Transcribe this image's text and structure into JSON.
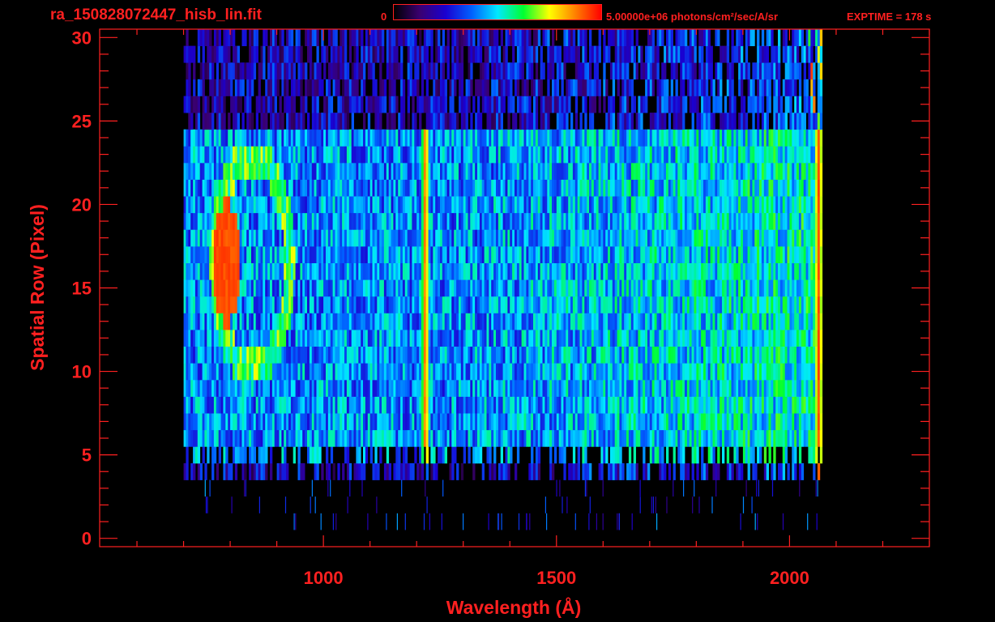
{
  "header": {
    "filename": "ra_150828072447_hisb_lin.fit",
    "colorbar_min_label": "0",
    "colorbar_max_label": "5.00000e+06 photons/cm²/sec/A/sr",
    "exptime_label": "EXPTIME = 178 s"
  },
  "colors": {
    "axis": "#ff2020",
    "background": "#000000",
    "colormap": [
      "#000000",
      "#3a0070",
      "#1a00d0",
      "#0060ff",
      "#00e8ff",
      "#00ff30",
      "#ffff00",
      "#ff8000",
      "#ff0000"
    ]
  },
  "chart_data": {
    "type": "heatmap",
    "title": "",
    "xlabel": "Wavelength (Å)",
    "ylabel": "Spatial Row (Pixel)",
    "xlim": [
      520,
      2300
    ],
    "ylim": [
      -0.5,
      30.5
    ],
    "xticks": [
      1000,
      1500,
      2000
    ],
    "xtick_labels": [
      "1000",
      "1500",
      "2000"
    ],
    "yticks": [
      0,
      5,
      10,
      15,
      20,
      25,
      30
    ],
    "ytick_labels": [
      "0",
      "5",
      "10",
      "15",
      "20",
      "25",
      "30"
    ],
    "x_minor_step": 100,
    "y_minor_step": 1,
    "colorbar_range": [
      0,
      5000000
    ],
    "colorbar_units": "photons/cm²/sec/A/sr",
    "data_extent": {
      "x": [
        700,
        2065
      ],
      "rows": [
        4,
        30
      ]
    },
    "features": [
      {
        "label": "",
        "wavelength": 1216,
        "rows": [
          5,
          24
        ],
        "level": 0.85
      },
      {
        "label": "",
        "wavelength": 1030,
        "rows": [
          5,
          23
        ],
        "level": 0.4
      },
      {
        "label": "",
        "wavelength": 1800,
        "rows": [
          7,
          23
        ],
        "level": 0.45
      },
      {
        "label": "",
        "wavelength": 2060,
        "rows": [
          2,
          30
        ],
        "level": 0.9
      },
      {
        "label": "",
        "row": 10.5,
        "wavelength_range": [
          800,
          1950
        ],
        "level": 0.55
      },
      {
        "label": "",
        "row": 11.5,
        "wavelength_range": [
          800,
          1850
        ],
        "level": 0.45
      },
      {
        "label": "",
        "row": 15.5,
        "wavelength_range": [
          1750,
          2050
        ],
        "level": 0.72
      },
      {
        "label": "",
        "center_wavelength": 790,
        "center_row": 16.5,
        "level": 0.95
      }
    ]
  }
}
